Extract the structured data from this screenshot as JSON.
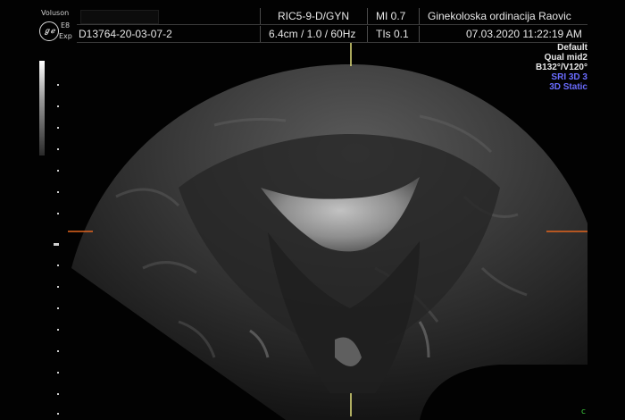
{
  "device": {
    "model_top": "Voluson",
    "model_mid": "E8",
    "model_bottom": "Exp",
    "logo_icon": "ge-logo-icon"
  },
  "header": {
    "probe": "RIC5-9-D/GYN",
    "mi": "MI  0.7",
    "clinic": "Ginekoloska ordinacija Raovic",
    "patient_id": "D13764-20-03-07-2",
    "depth_params": "6.4cm / 1.0 / 60Hz",
    "tis": "TIs  0.1",
    "datetime": "07.03.2020 11:22:19 AM"
  },
  "presets": {
    "line1": "Default",
    "line2": "Qual mid2",
    "line3": "B132°/V120°",
    "line4": "SRI 3D 3",
    "line5": "3D Static"
  },
  "colors": {
    "marker_orange": "#e2641e",
    "marker_yellow": "#e3e07a",
    "preset_blue": "#6a6cff",
    "corner_green": "#3cc83c"
  },
  "corner_mark": "c"
}
